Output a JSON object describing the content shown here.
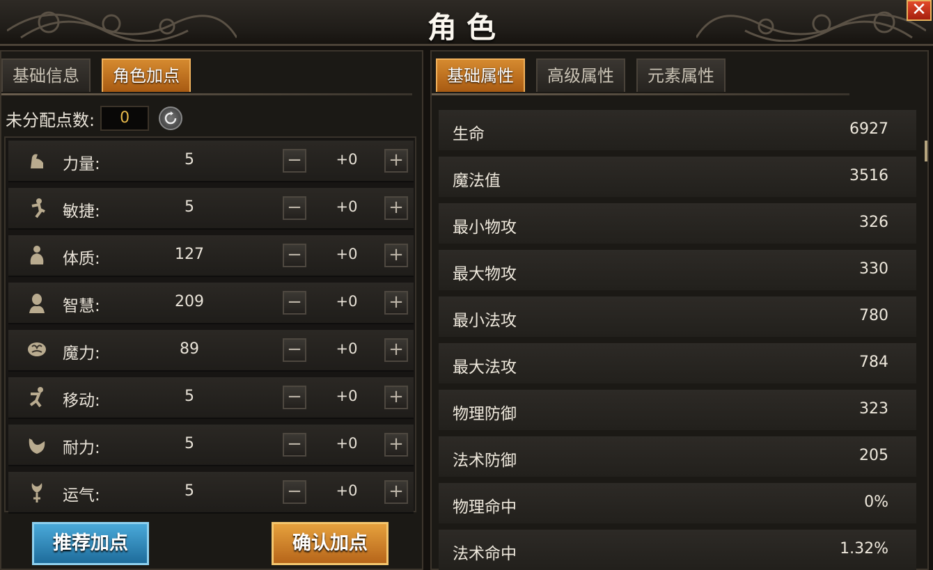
{
  "window": {
    "title": "角色",
    "close_label": "✕"
  },
  "left_tabs": [
    {
      "label": "基础信息",
      "active": false
    },
    {
      "label": "角色加点",
      "active": true
    }
  ],
  "points": {
    "label": "未分配点数:",
    "value": "0"
  },
  "attributes": [
    {
      "name": "力量:",
      "value": "5",
      "add": "+0",
      "icon": "arm-icon"
    },
    {
      "name": "敏捷:",
      "value": "5",
      "add": "+0",
      "icon": "runner-icon"
    },
    {
      "name": "体质:",
      "value": "127",
      "add": "+0",
      "icon": "body-icon"
    },
    {
      "name": "智慧:",
      "value": "209",
      "add": "+0",
      "icon": "head-icon"
    },
    {
      "name": "魔力:",
      "value": "89",
      "add": "+0",
      "icon": "brain-icon"
    },
    {
      "name": "移动:",
      "value": "5",
      "add": "+0",
      "icon": "move-icon"
    },
    {
      "name": "耐力:",
      "value": "5",
      "add": "+0",
      "icon": "stamina-icon"
    },
    {
      "name": "运气:",
      "value": "5",
      "add": "+0",
      "icon": "luck-icon"
    }
  ],
  "buttons": {
    "recommend": "推荐加点",
    "confirm": "确认加点",
    "minus": "−",
    "plus": "+"
  },
  "right_tabs": [
    {
      "label": "基础属性",
      "active": true
    },
    {
      "label": "高级属性",
      "active": false
    },
    {
      "label": "元素属性",
      "active": false
    }
  ],
  "stats": [
    {
      "name": "生命",
      "value": "6927"
    },
    {
      "name": "魔法值",
      "value": "3516"
    },
    {
      "name": "最小物攻",
      "value": "326"
    },
    {
      "name": "最大物攻",
      "value": "330"
    },
    {
      "name": "最小法攻",
      "value": "780"
    },
    {
      "name": "最大法攻",
      "value": "784"
    },
    {
      "name": "物理防御",
      "value": "323"
    },
    {
      "name": "法术防御",
      "value": "205"
    },
    {
      "name": "物理命中",
      "value": "0%"
    },
    {
      "name": "法术命中",
      "value": "1.32%"
    }
  ],
  "colors": {
    "accent": "#c97a24",
    "recommend": "#2f8cc0",
    "close": "#c8321a",
    "points": "#e6b84a"
  }
}
